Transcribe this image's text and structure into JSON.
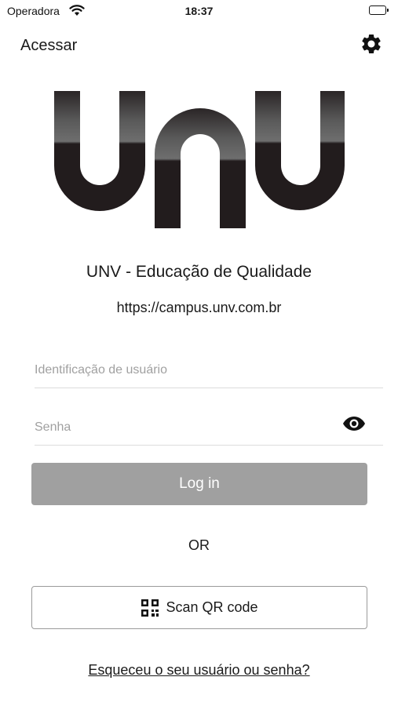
{
  "status_bar": {
    "carrier": "Operadora",
    "time": "18:37"
  },
  "nav": {
    "title": "Acessar"
  },
  "org": {
    "name": "UNV - Educação de Qualidade",
    "url": "https://campus.unv.com.br",
    "logo_text": "UNV"
  },
  "form": {
    "username_placeholder": "Identificação de usuário",
    "password_placeholder": "Senha",
    "username_value": "",
    "password_value": ""
  },
  "actions": {
    "login_label": "Log in",
    "or_label": "OR",
    "scan_qr_label": "Scan QR code",
    "forgot_label": "Esqueceu o seu usuário ou senha?"
  },
  "colors": {
    "login_button_bg": "#a0a0a0",
    "logo_dark": "#221c1d",
    "logo_light": "#6a6a6a"
  },
  "icons": {
    "settings": "gear-icon",
    "wifi": "wifi-icon",
    "battery": "battery-icon",
    "show_password": "eye-icon",
    "qr": "qr-code-icon"
  }
}
